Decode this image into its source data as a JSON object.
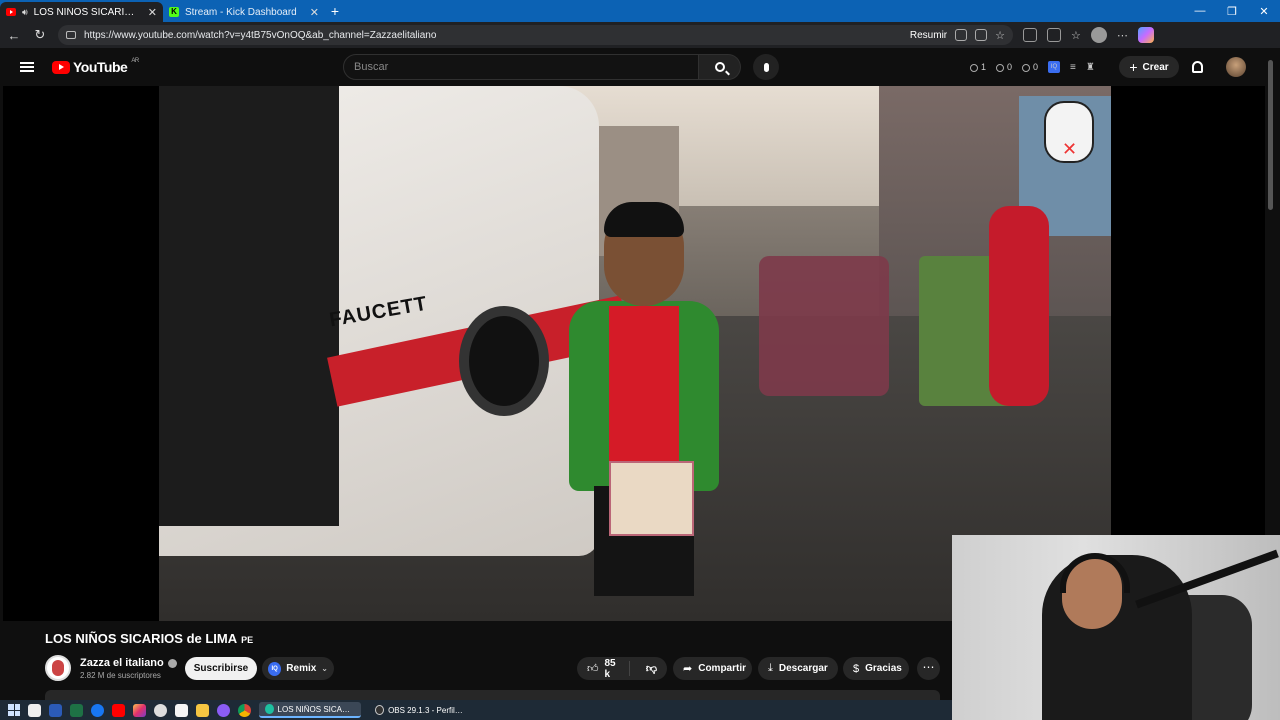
{
  "browser": {
    "tabs": [
      {
        "title": "LOS NIÑOS SICARIOS de LIMA",
        "favicon": "youtube-icon",
        "active": true
      },
      {
        "title": "Stream - Kick Dashboard",
        "favicon": "kick-icon",
        "active": false
      }
    ],
    "url": "https://www.youtube.com/watch?v=y4tB75vOnOQ&ab_channel=Zazzaelitaliano",
    "summarize_label": "Resumir"
  },
  "youtube": {
    "logo_text": "YouTube",
    "logo_region": "AR",
    "search_placeholder": "Buscar",
    "ext_stats": [
      "1",
      "0",
      "0"
    ],
    "create_label": "Crear",
    "accent_color": "#ff0000"
  },
  "video": {
    "title": "LOS NIÑOS SICARIOS de LIMA",
    "title_flag": "PE",
    "bus_lettering": "FAUCETT"
  },
  "channel": {
    "name": "Zazza el italiano",
    "subscribers": "2.82 M de suscriptores",
    "subscribe_label": "Suscribirse",
    "remix_label": "Remix"
  },
  "actions": {
    "likes": "85 k",
    "share_label": "Compartir",
    "download_label": "Descargar",
    "thanks_label": "Gracias"
  },
  "taskbar": {
    "tasks": [
      {
        "title": "LOS NIÑOS SICARIOS...",
        "active": true
      },
      {
        "title": "OBS 29.1.3 - Perfil: Si...",
        "active": false
      }
    ]
  }
}
